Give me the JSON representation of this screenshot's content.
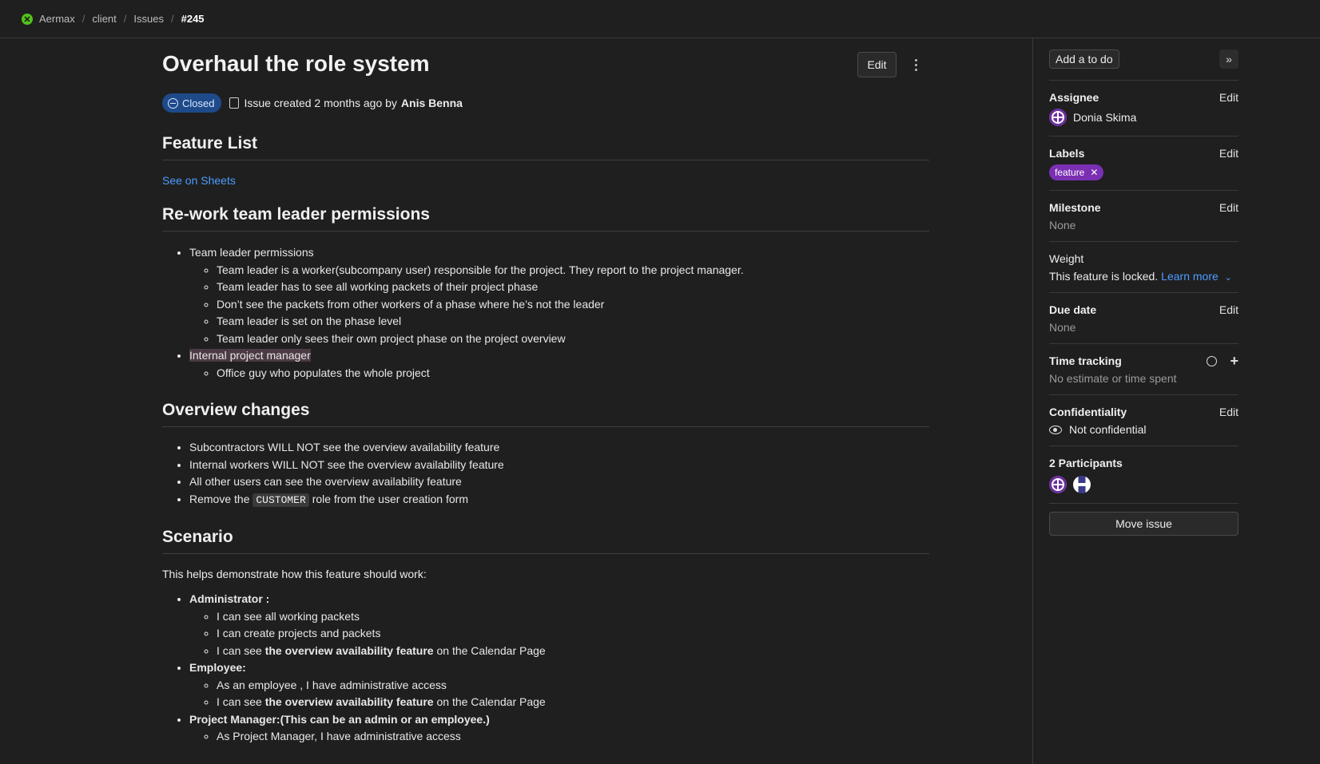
{
  "breadcrumb": {
    "items": [
      "Aermax",
      "client",
      "Issues",
      "#245"
    ]
  },
  "issue": {
    "title": "Overhaul the role system",
    "edit_label": "Edit",
    "status": "Closed",
    "created_text": "Issue created 2 months ago by",
    "author": "Anis Benna"
  },
  "sections": {
    "feature_list": {
      "heading": "Feature List",
      "link": "See on Sheets"
    },
    "rework": {
      "heading": "Re-work team leader permissions",
      "item1": "Team leader permissions",
      "item1_sub": [
        "Team leader is a worker(subcompany user) responsible for the project. They report to the project manager.",
        "Team leader has to see all working packets of their project phase",
        "Don’t see the packets from other workers of a phase where he’s not the leader",
        "Team leader is set on the phase level",
        "Team leader only sees their own project phase on the project overview"
      ],
      "item2": "Internal project manager",
      "item2_sub": [
        "Office guy who populates the whole project"
      ]
    },
    "overview": {
      "heading": "Overview changes",
      "items": [
        "Subcontractors WILL NOT see the overview availability feature",
        "Internal workers WILL NOT see the overview availability feature",
        "All other users can see the overview availability feature"
      ],
      "last_prefix": "Remove the",
      "last_code": "CUSTOMER",
      "last_suffix": "role from the user creation form"
    },
    "scenario": {
      "heading": "Scenario",
      "intro": "This helps demonstrate how this feature should work:",
      "admin": {
        "title": "Administrator :",
        "sub1": "I can see all working packets",
        "sub2": "I can create projects and packets",
        "sub3_prefix": "I can see",
        "sub3_bold": "the overview availability feature",
        "sub3_suffix": "on the Calendar Page"
      },
      "employee": {
        "title": "Employee:",
        "sub1": "As an employee , I have administrative access",
        "sub2_prefix": "I can see",
        "sub2_bold": "the overview availability feature",
        "sub2_suffix": "on the Calendar Page"
      },
      "pm": {
        "title": "Project Manager:(This can be an admin or an employee.)",
        "sub1": "As Project Manager, I have administrative access"
      }
    }
  },
  "sidebar": {
    "todo_label": "Add a to do",
    "assignee": {
      "heading": "Assignee",
      "edit": "Edit",
      "name": "Donia Skima"
    },
    "labels": {
      "heading": "Labels",
      "edit": "Edit",
      "label": "feature"
    },
    "milestone": {
      "heading": "Milestone",
      "edit": "Edit",
      "value": "None"
    },
    "weight": {
      "heading": "Weight",
      "text": "This feature is locked.",
      "learn_more": "Learn more"
    },
    "due_date": {
      "heading": "Due date",
      "edit": "Edit",
      "value": "None"
    },
    "time_tracking": {
      "heading": "Time tracking",
      "value": "No estimate or time spent"
    },
    "confidentiality": {
      "heading": "Confidentiality",
      "edit": "Edit",
      "value": "Not confidential"
    },
    "participants": {
      "heading": "2 Participants"
    },
    "move_label": "Move issue"
  },
  "colors": {
    "background": "#1f1f1f",
    "link": "#4c9dff",
    "status_badge": "#1f4a8a",
    "label_pill": "#7b2fb3",
    "logo": "#52c41a"
  },
  "icons": [
    "app-logo-icon",
    "closed-status-icon",
    "issue-doc-icon",
    "kebab-menu-icon",
    "collapse-sidebar-icon",
    "timer-icon",
    "plus-icon",
    "eye-icon",
    "close-icon",
    "chevron-down-icon"
  ]
}
